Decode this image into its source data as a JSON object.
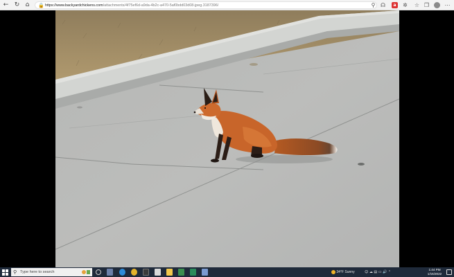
{
  "browser": {
    "url_host": "https://www.backyardchickens.com",
    "url_path": "/attachments/4f75ef6d-a9da-4b2c-a470-5af0bdd03d08-jpeg.3187396/",
    "nav": {
      "back_icon": "arrow-left-icon",
      "reload_icon": "reload-icon",
      "home_icon": "home-icon"
    }
  },
  "photo": {
    "subject": "red fox sitting on pavement",
    "colors": {
      "grass": "#a08a63",
      "curb": "#c9ccc9",
      "road": "#b9bcbc",
      "fox": "#c8652a"
    }
  },
  "taskbar": {
    "search_placeholder": "Type here to search",
    "weather_temp": "34°F",
    "weather_text": "Sunny",
    "clock_time": "1:44 PM",
    "clock_date": "1/15/2022"
  }
}
